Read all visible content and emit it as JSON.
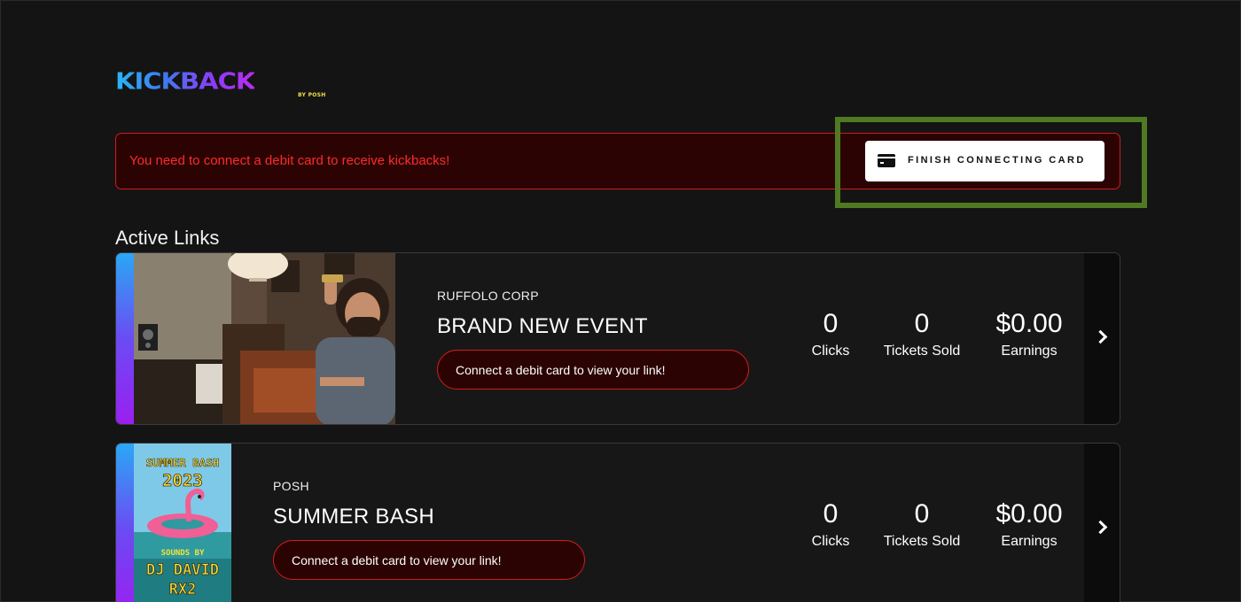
{
  "brand": {
    "name": "KICKBACK",
    "sub": "BY POSH",
    "gradient": [
      "#29b6f6",
      "#8b3cf5",
      "#b92cf2"
    ],
    "sub_color": "#f2e04a"
  },
  "alert": {
    "message": "You need to connect a debit card to receive kickbacks!",
    "button_label": "FINISH CONNECTING CARD",
    "button_icon": "credit-card-icon",
    "color": "#ff2a2a",
    "highlight_color": "#4f7a22"
  },
  "active_links": {
    "title": "Active Links",
    "events": [
      {
        "org": "RUFFOLO CORP",
        "title": "BRAND NEW EVENT",
        "link_message": "Connect a debit card to view your link!",
        "clicks_value": "0",
        "clicks_label": "Clicks",
        "tickets_value": "0",
        "tickets_label": "Tickets Sold",
        "earnings_value": "$0.00",
        "earnings_label": "Earnings"
      },
      {
        "org": "POSH",
        "title": "SUMMER BASH",
        "link_message": "Connect a debit card to view your link!",
        "clicks_value": "0",
        "clicks_label": "Clicks",
        "tickets_value": "0",
        "tickets_label": "Tickets Sold",
        "earnings_value": "$0.00",
        "earnings_label": "Earnings",
        "poster": {
          "line1": "SUMMER BASH",
          "line2": "2023",
          "line3": "SOUNDS BY",
          "line4": "DJ DAVID",
          "line5": "RX2"
        }
      }
    ]
  }
}
